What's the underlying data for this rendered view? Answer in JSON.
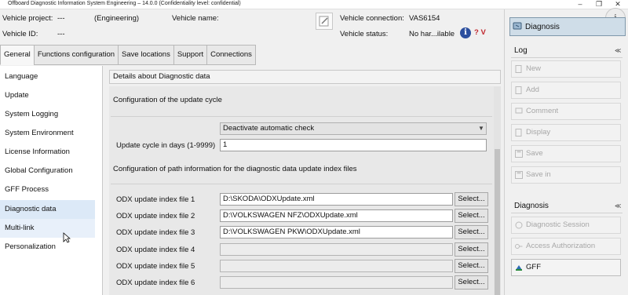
{
  "window": {
    "title": "Offboard Diagnostic Information System Engineering – 14.0.0 (Confidentiality level: confidential)",
    "minimize": "–",
    "maximize": "❐",
    "close": "✕"
  },
  "header": {
    "vehicle_project_label": "Vehicle project:",
    "vehicle_project_value": "---",
    "engineering": "(Engineering)",
    "vehicle_name_label": "Vehicle name:",
    "vehicle_id_label": "Vehicle ID:",
    "vehicle_id_value": "---",
    "connection_label": "Vehicle connection:",
    "connection_value": "VAS6154",
    "status_label": "Vehicle status:",
    "status_value": "No har...ilable",
    "info_icon": "i",
    "help_text": "? V"
  },
  "tabs": [
    "General",
    "Functions configuration",
    "Save locations",
    "Support",
    "Connections"
  ],
  "nav": {
    "items": [
      "Language",
      "Update",
      "System Logging",
      "System Environment",
      "License Information",
      "Global Configuration",
      "GFF Process",
      "Diagnostic data",
      "Multi-link",
      "Personalization"
    ],
    "selected": "Diagnostic data"
  },
  "content": {
    "header": "Details about Diagnostic data",
    "update_cycle_section": "Configuration of the update cycle",
    "auto_check_value": "Deactivate automatic check",
    "update_cycle_label": "Update cycle in days (1-9999)",
    "update_cycle_value": "1",
    "path_section": "Configuration of path information for the diagnostic data update index files",
    "odx_files": [
      {
        "label": "ODX update index file 1",
        "value": "D:\\SKODA\\ODXUpdate.xml",
        "button": "Select..."
      },
      {
        "label": "ODX update index file 2",
        "value": "D:\\VOLKSWAGEN NFZ\\ODXUpdate.xml",
        "button": "Select..."
      },
      {
        "label": "ODX update index file 3",
        "value": "D:\\VOLKSWAGEN PKW\\ODXUpdate.xml",
        "button": "Select..."
      },
      {
        "label": "ODX update index file 4",
        "value": "",
        "button": "Select..."
      },
      {
        "label": "ODX update index file 5",
        "value": "",
        "button": "Select..."
      },
      {
        "label": "ODX update index file 6",
        "value": "",
        "button": "Select..."
      }
    ]
  },
  "right_panel": {
    "diagnosis_button": "Diagnosis",
    "info_button": "i",
    "log_group": "Log",
    "log_buttons": [
      "New",
      "Add",
      "Comment",
      "Display",
      "Save",
      "Save in"
    ],
    "diagnosis_group": "Diagnosis",
    "diagnosis_buttons": [
      "Diagnostic Session",
      "Access Authorization",
      "GFF"
    ],
    "collapse_glyph": "≪"
  },
  "colors": {
    "selection": "#dce9f7",
    "diagnosis_button_bg": "#cfdde8",
    "info_icon": "#2c4f9e",
    "help_red": "#c0262d",
    "disabled_text": "#a7a7a7"
  }
}
